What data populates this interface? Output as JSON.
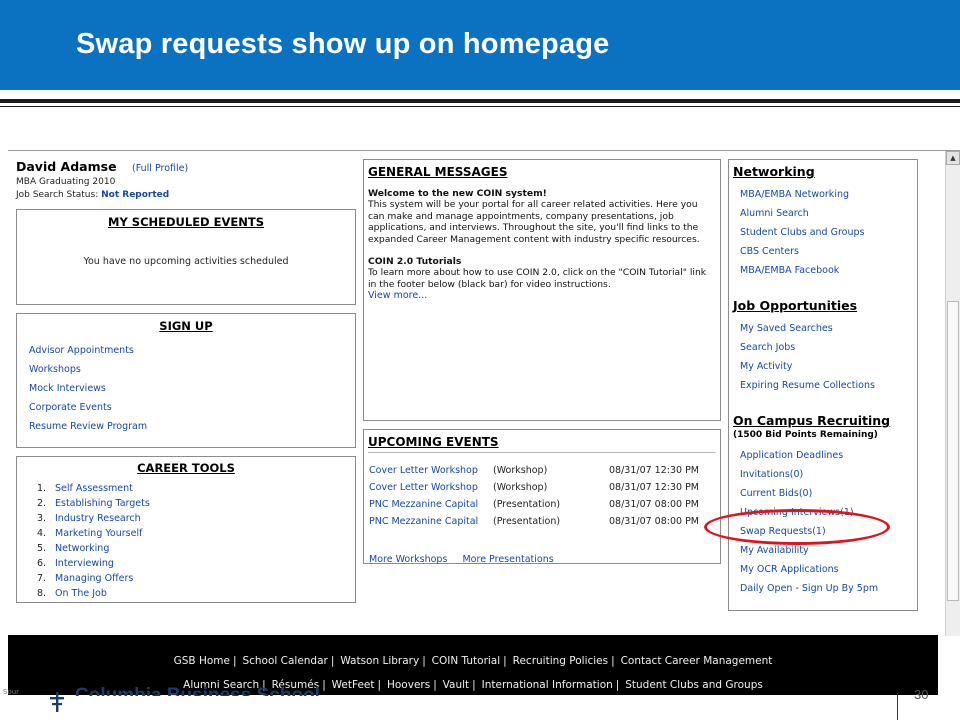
{
  "slide": {
    "title": "Swap requests show up on homepage",
    "page_number": "30",
    "logo_text": "Columbia Business School",
    "source_label": "Sour"
  },
  "profile": {
    "name": "David Adamse",
    "full_profile_link": "(Full Profile)",
    "program": "MBA  Graduating 2010",
    "job_status_label": "Job Search Status:",
    "job_status_value": "Not Reported"
  },
  "scheduled_events": {
    "title": "MY SCHEDULED EVENTS",
    "empty_text": "You have no upcoming activities scheduled"
  },
  "sign_up": {
    "title": "SIGN UP",
    "items": [
      "Advisor Appointments",
      "Workshops",
      "Mock Interviews",
      "Corporate Events",
      "Resume Review Program"
    ]
  },
  "career_tools": {
    "title": "CAREER TOOLS",
    "items": [
      {
        "num": "1.",
        "label": "Self Assessment"
      },
      {
        "num": "2.",
        "label": "Establishing Targets"
      },
      {
        "num": "3.",
        "label": "Industry Research"
      },
      {
        "num": "4.",
        "label": "Marketing Yourself"
      },
      {
        "num": "5.",
        "label": "Networking"
      },
      {
        "num": "6.",
        "label": "Interviewing"
      },
      {
        "num": "7.",
        "label": "Managing Offers"
      },
      {
        "num": "8.",
        "label": "On The Job"
      }
    ]
  },
  "general_messages": {
    "title": "GENERAL MESSAGES",
    "welcome_heading": "Welcome to the new COIN system!",
    "welcome_body": "This system will be your portal for all career related activities. Here you can make and manage appointments, company presentations, job applications, and interviews. Throughout the site, you'll find links to the expanded Career Management content with industry specific resources.",
    "tutorials_heading": "COIN 2.0 Tutorials",
    "tutorials_body": "To learn more about how to use COIN 2.0, click on the \"COIN Tutorial\" link in the footer below (black bar) for video instructions.",
    "view_more": "View more..."
  },
  "upcoming_events": {
    "title": "UPCOMING EVENTS",
    "rows": [
      {
        "name": "Cover Letter Workshop",
        "type": "(Workshop)",
        "time": "08/31/07 12:30 PM"
      },
      {
        "name": "Cover Letter Workshop",
        "type": "(Workshop)",
        "time": "08/31/07 12:30 PM"
      },
      {
        "name": "PNC Mezzanine Capital",
        "type": "(Presentation)",
        "time": "08/31/07 08:00 PM"
      },
      {
        "name": "PNC Mezzanine Capital",
        "type": "(Presentation)",
        "time": "08/31/07 08:00 PM"
      }
    ],
    "more_workshops": "More Workshops",
    "more_presentations": "More Presentations"
  },
  "networking": {
    "title": "Networking",
    "items": [
      "MBA/EMBA Networking",
      "Alumni Search",
      "Student Clubs and Groups",
      "CBS Centers",
      "MBA/EMBA Facebook"
    ]
  },
  "job_opportunities": {
    "title": "Job Opportunities",
    "items": [
      "My Saved Searches",
      "Search Jobs",
      "My Activity",
      "Expiring Resume Collections"
    ]
  },
  "on_campus": {
    "title": "On Campus Recruiting",
    "subtitle": "(1500 Bid Points Remaining)",
    "items": [
      "Application Deadlines",
      "Invitations(0)",
      "Current Bids(0)",
      "Upcoming Interviews(1)",
      "Swap Requests(1)",
      "My Availability",
      "My OCR Applications",
      "Daily Open - Sign Up By 5pm"
    ]
  },
  "footer": {
    "row1": [
      "GSB Home",
      "School Calendar",
      "Watson Library",
      "COIN Tutorial",
      "Recruiting Policies",
      "Contact Career Management"
    ],
    "row2": [
      "Alumni Search",
      "Résumés",
      "WetFeet",
      "Hoovers",
      "Vault",
      "International Information",
      "Student Clubs and Groups"
    ]
  },
  "colors": {
    "header_blue": "#0a72c0",
    "link_blue": "#1549a6",
    "highlight_red": "#e1131b",
    "footer_black": "#000000"
  }
}
